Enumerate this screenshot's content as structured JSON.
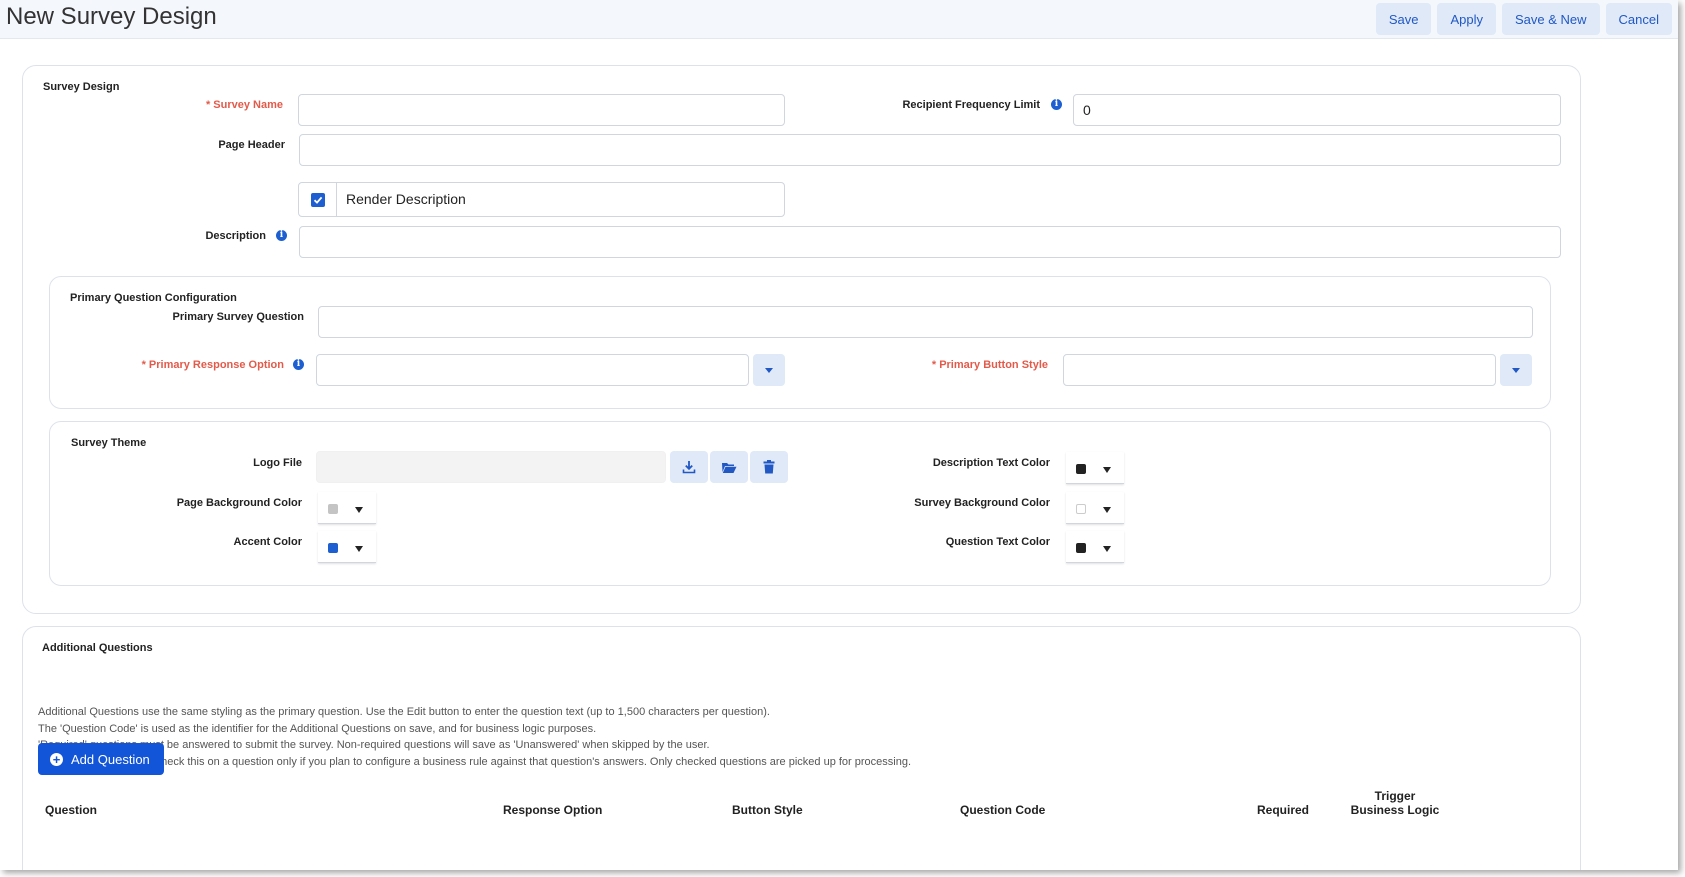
{
  "header": {
    "title": "New Survey Design",
    "buttons": {
      "save": "Save",
      "apply": "Apply",
      "save_new": "Save & New",
      "cancel": "Cancel"
    }
  },
  "survey_design": {
    "section_title": "Survey Design",
    "survey_name": {
      "label": "Survey Name",
      "required_mark": "*",
      "value": ""
    },
    "recipient_frequency_limit": {
      "label": "Recipient Frequency Limit",
      "value": "0"
    },
    "page_header": {
      "label": "Page Header",
      "value": ""
    },
    "render_description": {
      "label": "Render Description",
      "checked": true
    },
    "description": {
      "label": "Description",
      "value": ""
    }
  },
  "primary_question": {
    "section_title": "Primary Question Configuration",
    "primary_survey_question": {
      "label": "Primary Survey Question",
      "value": ""
    },
    "primary_response_option": {
      "label": "Primary Response Option",
      "required_mark": "*",
      "value": ""
    },
    "primary_button_style": {
      "label": "Primary Button Style",
      "required_mark": "*",
      "value": ""
    }
  },
  "survey_theme": {
    "section_title": "Survey Theme",
    "logo_file": {
      "label": "Logo File",
      "value": ""
    },
    "description_text_color": {
      "label": "Description Text Color",
      "color": "#222222"
    },
    "page_background_color": {
      "label": "Page Background Color",
      "color": "#c4c4c4"
    },
    "survey_background_color": {
      "label": "Survey Background Color",
      "color": "#ffffff"
    },
    "accent_color": {
      "label": "Accent Color",
      "color": "#1d5fd1"
    },
    "question_text_color": {
      "label": "Question Text Color",
      "color": "#222222"
    }
  },
  "additional_questions": {
    "section_title": "Additional Questions",
    "help_lines": [
      "Additional Questions use the same styling as the primary question. Use the Edit button to enter the question text (up to 1,500 characters per question).",
      "The 'Question Code' is used as the identifier for the Additional Questions on save, and for business logic purposes.",
      "'Required' questions must be answered to submit the survey. Non-required questions will save as 'Unanswered' when skipped by the user.",
      "Trigger Business Logic: check this on a question only if you plan to configure a business rule against that question's answers. Only checked questions are picked up for processing."
    ],
    "add_button": "Add Question",
    "columns": {
      "question": "Question",
      "response_option": "Response Option",
      "button_style": "Button Style",
      "question_code": "Question Code",
      "required": "Required",
      "trigger_line1": "Trigger",
      "trigger_line2": "Business Logic"
    }
  },
  "colors": {
    "accent": "#1255d8",
    "soft_button": "#dfe9f8",
    "required": "#e35a4a"
  }
}
